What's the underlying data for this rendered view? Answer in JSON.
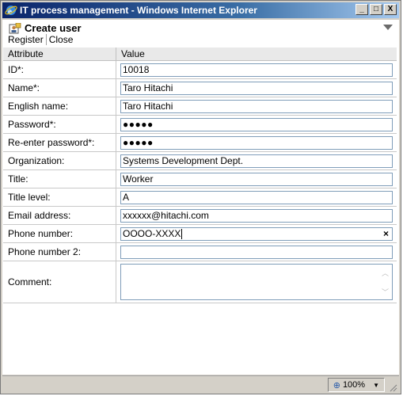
{
  "window": {
    "title": "IT process management - Windows Internet Explorer",
    "minimize": "_",
    "maximize": "□",
    "close": "X"
  },
  "page": {
    "heading": "Create user",
    "toolbar": {
      "register": "Register",
      "close": "Close"
    }
  },
  "table": {
    "headers": {
      "attribute": "Attribute",
      "value": "Value"
    },
    "rows": [
      {
        "label": "ID*:",
        "value": "10018"
      },
      {
        "label": "Name*:",
        "value": "Taro Hitachi"
      },
      {
        "label": "English name:",
        "value": "Taro Hitachi"
      },
      {
        "label": "Password*:",
        "value": "●●●●●"
      },
      {
        "label": "Re-enter password*:",
        "value": "●●●●●"
      },
      {
        "label": "Organization:",
        "value": "Systems Development Dept."
      },
      {
        "label": "Title:",
        "value": "Worker"
      },
      {
        "label": "Title level:",
        "value": "A"
      },
      {
        "label": "Email address:",
        "value": "xxxxxx@hitachi.com"
      },
      {
        "label": "Phone number:",
        "value": "OOOO-XXXX",
        "clear": "×"
      },
      {
        "label": "Phone number 2:",
        "value": ""
      },
      {
        "label": "Comment:",
        "value": ""
      }
    ]
  },
  "status": {
    "zoom": "100%",
    "zoom_icon": "magnifier-icon"
  }
}
